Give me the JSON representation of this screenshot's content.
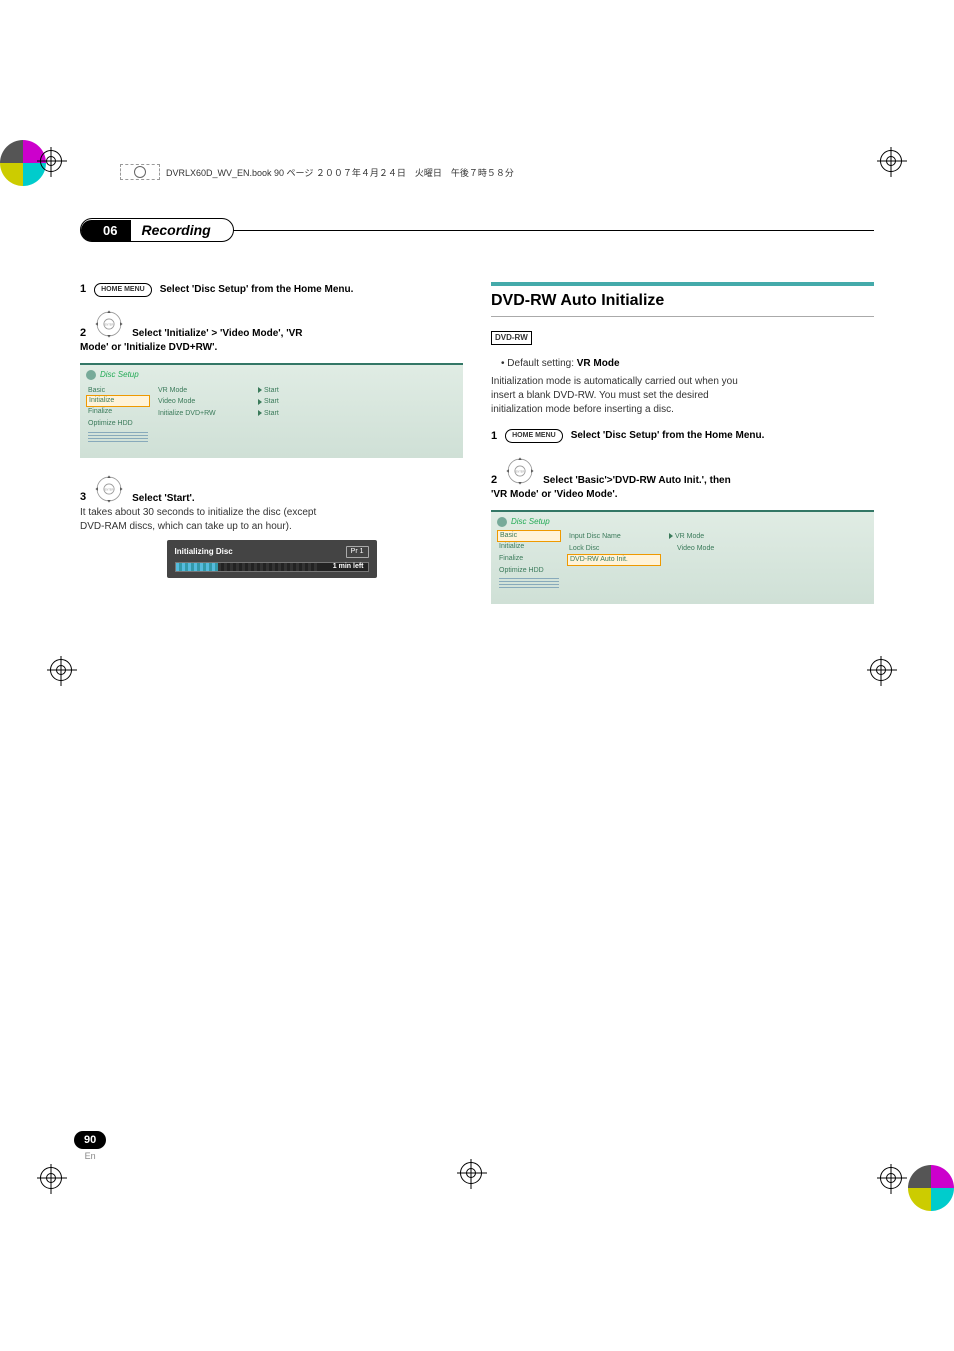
{
  "header_text": "DVRLX60D_WV_EN.book  90 ページ  ２００７年４月２４日　火曜日　午後７時５８分",
  "chapter_num": "06",
  "chapter_title": "Recording",
  "left": {
    "step1_num": "1",
    "step1_btn": "HOME MENU",
    "step1_text": "Select 'Disc Setup' from the Home Menu.",
    "step2_num": "2",
    "step2_text_a": "Select 'Initialize' > 'Video Mode', 'VR",
    "step2_text_b": "Mode' or 'Initialize DVD+RW'.",
    "sc1": {
      "title": "Disc Setup",
      "left": [
        "Basic",
        "Initialize",
        "Finalize",
        "Optimize HDD"
      ],
      "mid": [
        "VR Mode",
        "Video Mode",
        "Initialize DVD+RW"
      ],
      "right": [
        "Start",
        "Start",
        "Start"
      ],
      "selected_left_index": 1
    },
    "step3_num": "3",
    "step3_text": "Select 'Start'.",
    "after3_a": "It takes about 30 seconds to initialize the disc (except",
    "after3_b": "DVD-RAM discs, which can take up to an hour).",
    "init_title": "Initializing Disc",
    "init_pr": "Pr 1",
    "init_time": "1 min left"
  },
  "right": {
    "h2": "DVD-RW Auto Initialize",
    "badge": "DVD-RW",
    "bullet_a": "Default setting: ",
    "bullet_b": "VR Mode",
    "para_a": "Initialization mode is automatically carried out when you",
    "para_b": "insert a blank DVD-RW. You must set the desired",
    "para_c": "initialization mode before inserting a disc.",
    "step1_num": "1",
    "step1_btn": "HOME MENU",
    "step1_text": "Select 'Disc Setup' from the Home Menu.",
    "step2_num": "2",
    "step2_text_a": "Select 'Basic'>'DVD-RW Auto Init.', then",
    "step2_text_b": "'VR Mode' or 'Video Mode'.",
    "sc2": {
      "title": "Disc Setup",
      "left": [
        "Basic",
        "Initialize",
        "Finalize",
        "Optimize HDD"
      ],
      "mid": [
        "Input Disc Name",
        "Lock Disc",
        "DVD-RW Auto Init."
      ],
      "right": [
        "VR Mode",
        "Video Mode"
      ],
      "selected_left_index": 0,
      "selected_mid_index": 2,
      "selected_right_index": 0
    }
  },
  "page_num": "90",
  "page_lang": "En"
}
